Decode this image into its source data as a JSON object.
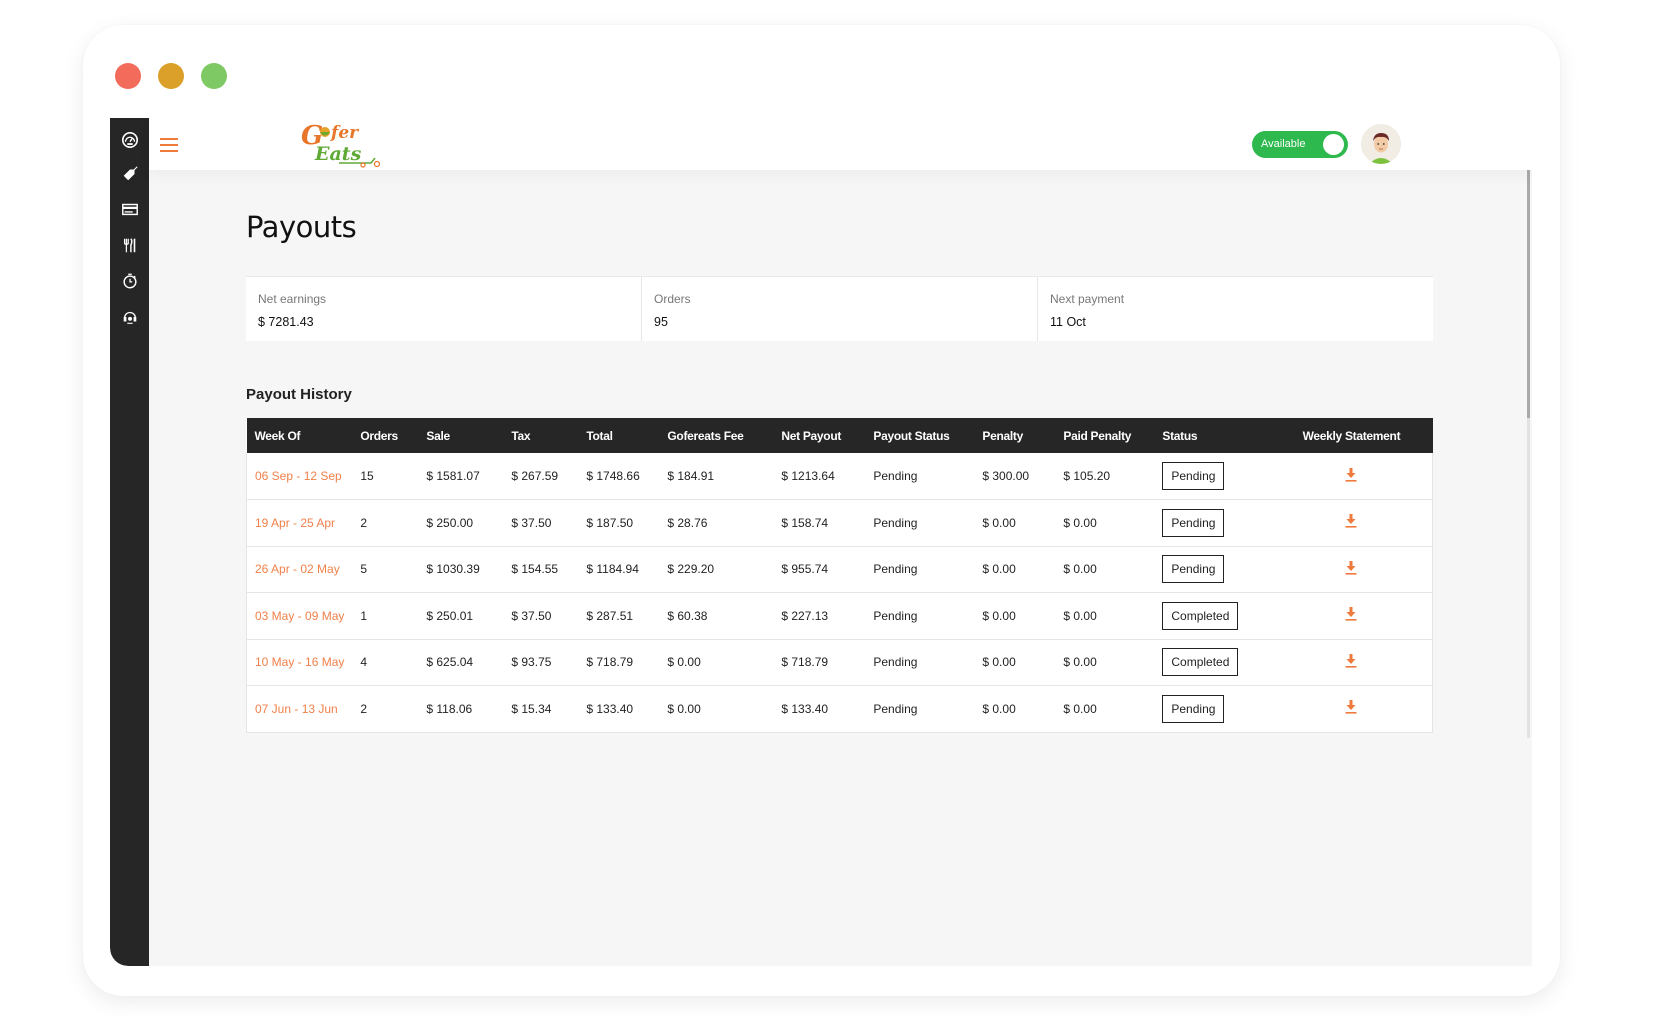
{
  "window": {
    "controls": [
      "close",
      "minimize",
      "maximize"
    ]
  },
  "sidebar": {
    "items": [
      {
        "name": "dashboard",
        "icon": "speedometer-icon"
      },
      {
        "name": "offers",
        "icon": "tag-icon"
      },
      {
        "name": "payouts",
        "icon": "credit-card-icon"
      },
      {
        "name": "menu",
        "icon": "utensils-icon"
      },
      {
        "name": "preparation-time",
        "icon": "stopwatch-icon"
      },
      {
        "name": "support",
        "icon": "headset-icon"
      }
    ]
  },
  "header": {
    "logo_alt": "Gofer Eats",
    "availability_label": "Available",
    "availability_on": true,
    "colors": {
      "accent": "#ef7a3c",
      "toggle": "#2db94d"
    }
  },
  "page": {
    "title": "Payouts",
    "summary": [
      {
        "label": "Net earnings",
        "value": "$ 7281.43"
      },
      {
        "label": "Orders",
        "value": "95"
      },
      {
        "label": "Next payment",
        "value": "11 Oct"
      }
    ],
    "history_title": "Payout History",
    "table": {
      "columns": [
        "Week Of",
        "Orders",
        "Sale",
        "Tax",
        "Total",
        "Gofereats Fee",
        "Net Payout",
        "Payout Status",
        "Penalty",
        "Paid Penalty",
        "Status",
        "Weekly Statement"
      ],
      "rows": [
        {
          "week": "06 Sep - 12 Sep",
          "orders": "15",
          "sale": "$ 1581.07",
          "tax": "$ 267.59",
          "total": "$ 1748.66",
          "fee": "$ 184.91",
          "net": "$ 1213.64",
          "payout_status": "Pending",
          "penalty": "$ 300.00",
          "paid_penalty": "$ 105.20",
          "status": "Pending"
        },
        {
          "week": "19 Apr - 25 Apr",
          "orders": "2",
          "sale": "$ 250.00",
          "tax": "$ 37.50",
          "total": "$ 187.50",
          "fee": "$ 28.76",
          "net": "$ 158.74",
          "payout_status": "Pending",
          "penalty": "$ 0.00",
          "paid_penalty": "$ 0.00",
          "status": "Pending"
        },
        {
          "week": "26 Apr - 02 May",
          "orders": "5",
          "sale": "$ 1030.39",
          "tax": "$ 154.55",
          "total": "$ 1184.94",
          "fee": "$ 229.20",
          "net": "$ 955.74",
          "payout_status": "Pending",
          "penalty": "$ 0.00",
          "paid_penalty": "$ 0.00",
          "status": "Pending"
        },
        {
          "week": "03 May - 09 May",
          "orders": "1",
          "sale": "$ 250.01",
          "tax": "$ 37.50",
          "total": "$ 287.51",
          "fee": "$ 60.38",
          "net": "$ 227.13",
          "payout_status": "Pending",
          "penalty": "$ 0.00",
          "paid_penalty": "$ 0.00",
          "status": "Completed"
        },
        {
          "week": "10 May - 16 May",
          "orders": "4",
          "sale": "$ 625.04",
          "tax": "$ 93.75",
          "total": "$ 718.79",
          "fee": "$ 0.00",
          "net": "$ 718.79",
          "payout_status": "Pending",
          "penalty": "$ 0.00",
          "paid_penalty": "$ 0.00",
          "status": "Completed"
        },
        {
          "week": "07 Jun - 13 Jun",
          "orders": "2",
          "sale": "$ 118.06",
          "tax": "$ 15.34",
          "total": "$ 133.40",
          "fee": "$ 0.00",
          "net": "$ 133.40",
          "payout_status": "Pending",
          "penalty": "$ 0.00",
          "paid_penalty": "$ 0.00",
          "status": "Pending"
        }
      ],
      "download_icon": "download-icon"
    }
  }
}
